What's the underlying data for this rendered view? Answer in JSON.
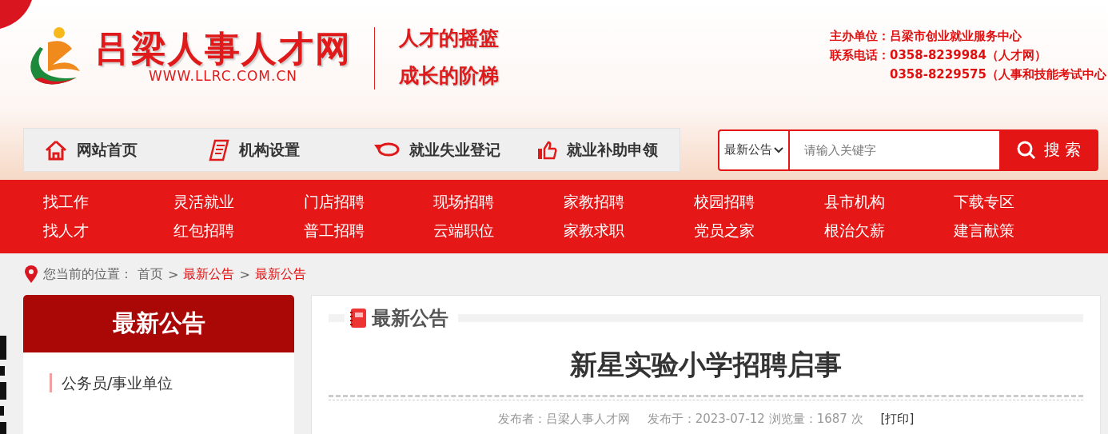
{
  "header": {
    "site_name": "吕梁人事人才网",
    "site_url": "WWW.LLRC.COM.CN",
    "slogans": [
      "人才的摇篮",
      "成长的阶梯"
    ],
    "contact": [
      {
        "label": "主办单位：",
        "value": "吕梁市创业就业服务中心"
      },
      {
        "label": "联系电话：",
        "value": "0358-8239984（人才网）"
      },
      {
        "value": "0358-8229575（人事和技能考试中心"
      }
    ]
  },
  "quick_nav": [
    {
      "kind": "home",
      "label": "网站首页"
    },
    {
      "kind": "doc",
      "label": "机构设置"
    },
    {
      "kind": "chat",
      "label": "就业失业登记"
    },
    {
      "kind": "thumb",
      "label": "就业补助申领"
    }
  ],
  "search": {
    "category": "最新公告",
    "placeholder": "请输入关键字",
    "button": "搜 索"
  },
  "menu": [
    [
      "找工作",
      "找人才"
    ],
    [
      "灵活就业",
      "红包招聘"
    ],
    [
      "门店招聘",
      "普工招聘"
    ],
    [
      "现场招聘",
      "云端职位"
    ],
    [
      "家教招聘",
      "家教求职"
    ],
    [
      "校园招聘",
      "党员之家"
    ],
    [
      "县市机构",
      "根治欠薪"
    ],
    [
      "下载专区",
      "建言献策"
    ]
  ],
  "breadcrumb": {
    "label": "您当前的位置：",
    "separator": ">",
    "items": [
      {
        "text": "首页",
        "current": false
      },
      {
        "text": "最新公告",
        "current": true
      },
      {
        "text": "最新公告",
        "current": true
      }
    ]
  },
  "sidebar": {
    "title": "最新公告",
    "items": [
      "公务员/事业单位"
    ]
  },
  "article": {
    "section": "最新公告",
    "title": "新星实验小学招聘启事",
    "publisher": "发布者：吕梁人事人才网",
    "date": "发布于：2023-07-12 浏览量：1687 次",
    "print": "[打印]"
  }
}
